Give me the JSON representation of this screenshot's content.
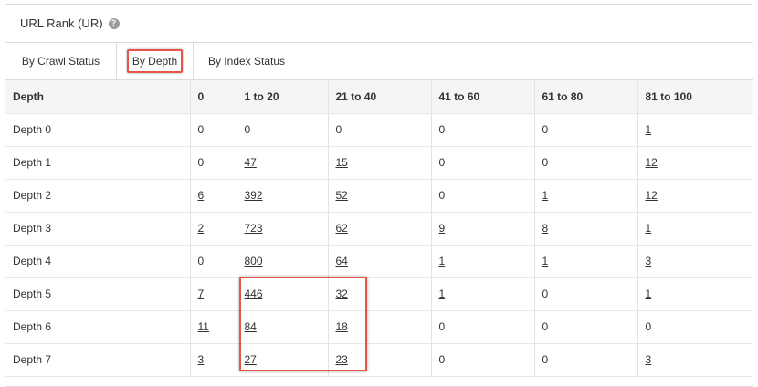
{
  "panel": {
    "title": "URL Rank (UR)",
    "help_icon": "question-circle-icon"
  },
  "tabs": [
    {
      "label": "By Crawl Status",
      "active": false
    },
    {
      "label": "By Depth",
      "active": true
    },
    {
      "label": "By Index Status",
      "active": false
    }
  ],
  "table": {
    "headers": [
      "Depth",
      "0",
      "1 to 20",
      "21 to 40",
      "41 to 60",
      "61 to 80",
      "81 to 100"
    ],
    "rows": [
      {
        "label": "Depth 0",
        "cells": [
          {
            "v": "0",
            "link": false
          },
          {
            "v": "0",
            "link": false
          },
          {
            "v": "0",
            "link": false
          },
          {
            "v": "0",
            "link": false
          },
          {
            "v": "0",
            "link": false
          },
          {
            "v": "1",
            "link": true
          }
        ]
      },
      {
        "label": "Depth 1",
        "cells": [
          {
            "v": "0",
            "link": false
          },
          {
            "v": "47",
            "link": true
          },
          {
            "v": "15",
            "link": true
          },
          {
            "v": "0",
            "link": false
          },
          {
            "v": "0",
            "link": false
          },
          {
            "v": "12",
            "link": true
          }
        ]
      },
      {
        "label": "Depth 2",
        "cells": [
          {
            "v": "6",
            "link": true
          },
          {
            "v": "392",
            "link": true
          },
          {
            "v": "52",
            "link": true
          },
          {
            "v": "0",
            "link": false
          },
          {
            "v": "1",
            "link": true
          },
          {
            "v": "12",
            "link": true
          }
        ]
      },
      {
        "label": "Depth 3",
        "cells": [
          {
            "v": "2",
            "link": true
          },
          {
            "v": "723",
            "link": true
          },
          {
            "v": "62",
            "link": true
          },
          {
            "v": "9",
            "link": true
          },
          {
            "v": "8",
            "link": true
          },
          {
            "v": "1",
            "link": true
          }
        ]
      },
      {
        "label": "Depth 4",
        "cells": [
          {
            "v": "0",
            "link": false
          },
          {
            "v": "800",
            "link": true
          },
          {
            "v": "64",
            "link": true
          },
          {
            "v": "1",
            "link": true
          },
          {
            "v": "1",
            "link": true
          },
          {
            "v": "3",
            "link": true
          }
        ]
      },
      {
        "label": "Depth 5",
        "cells": [
          {
            "v": "7",
            "link": true
          },
          {
            "v": "446",
            "link": true
          },
          {
            "v": "32",
            "link": true
          },
          {
            "v": "1",
            "link": true
          },
          {
            "v": "0",
            "link": false
          },
          {
            "v": "1",
            "link": true
          }
        ]
      },
      {
        "label": "Depth 6",
        "cells": [
          {
            "v": "11",
            "link": true
          },
          {
            "v": "84",
            "link": true
          },
          {
            "v": "18",
            "link": true
          },
          {
            "v": "0",
            "link": false
          },
          {
            "v": "0",
            "link": false
          },
          {
            "v": "0",
            "link": false
          }
        ]
      },
      {
        "label": "Depth 7",
        "cells": [
          {
            "v": "3",
            "link": true
          },
          {
            "v": "27",
            "link": true
          },
          {
            "v": "23",
            "link": true
          },
          {
            "v": "0",
            "link": false
          },
          {
            "v": "0",
            "link": false
          },
          {
            "v": "3",
            "link": true
          }
        ]
      }
    ]
  },
  "colors": {
    "highlight": "#e8534a",
    "border": "#dcdcdc",
    "header_bg": "#f5f5f5"
  }
}
